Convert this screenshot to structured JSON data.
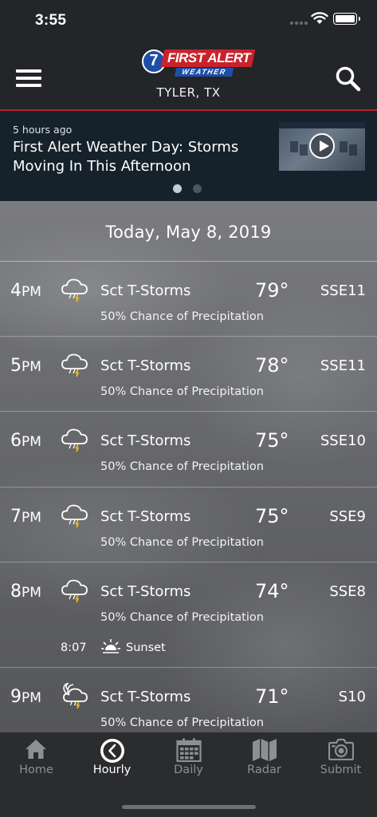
{
  "status_bar": {
    "time": "3:55"
  },
  "header": {
    "logo_number": "7",
    "logo_main": "FIRST ALERT",
    "logo_sub": "WEATHER",
    "location": "TYLER, TX"
  },
  "news": {
    "time_ago": "5 hours ago",
    "headline": "First Alert Weather Day: Storms Moving In This Afternoon",
    "pager": {
      "count": 2,
      "active_index": 0
    }
  },
  "forecast": {
    "date": "Today, May 8, 2019",
    "hours": [
      {
        "hour": "4",
        "period": "PM",
        "icon": "thunderstorm-cloud-icon",
        "condition": "Sct T-Storms",
        "temp": "79°",
        "wind": "SSE11",
        "precip": "50% Chance of Precipitation"
      },
      {
        "hour": "5",
        "period": "PM",
        "icon": "thunderstorm-cloud-icon",
        "condition": "Sct T-Storms",
        "temp": "78°",
        "wind": "SSE11",
        "precip": "50% Chance of Precipitation"
      },
      {
        "hour": "6",
        "period": "PM",
        "icon": "thunderstorm-cloud-icon",
        "condition": "Sct T-Storms",
        "temp": "75°",
        "wind": "SSE10",
        "precip": "50% Chance of Precipitation"
      },
      {
        "hour": "7",
        "period": "PM",
        "icon": "thunderstorm-cloud-icon",
        "condition": "Sct T-Storms",
        "temp": "75°",
        "wind": "SSE9",
        "precip": "50% Chance of Precipitation"
      },
      {
        "hour": "8",
        "period": "PM",
        "icon": "thunderstorm-cloud-icon",
        "condition": "Sct T-Storms",
        "temp": "74°",
        "wind": "SSE8",
        "precip": "50% Chance of Precipitation"
      },
      {
        "hour": "9",
        "period": "PM",
        "icon": "night-thunderstorm-icon",
        "condition": "Sct T-Storms",
        "temp": "71°",
        "wind": "S10",
        "precip": "50% Chance of Precipitation"
      }
    ],
    "sunset": {
      "time": "8:07",
      "label": "Sunset",
      "icon": "sunset-icon"
    }
  },
  "tabs": [
    {
      "label": "Home",
      "icon": "home-icon"
    },
    {
      "label": "Hourly",
      "icon": "clock-icon",
      "active": true
    },
    {
      "label": "Daily",
      "icon": "calendar-icon"
    },
    {
      "label": "Radar",
      "icon": "map-icon"
    },
    {
      "label": "Submit",
      "icon": "camera-icon"
    }
  ],
  "colors": {
    "header_bg": "#232528",
    "accent_red": "#b8202a",
    "news_bg": "#15212b",
    "tab_inactive": "#8d8f92",
    "tab_active": "#ffffff"
  }
}
